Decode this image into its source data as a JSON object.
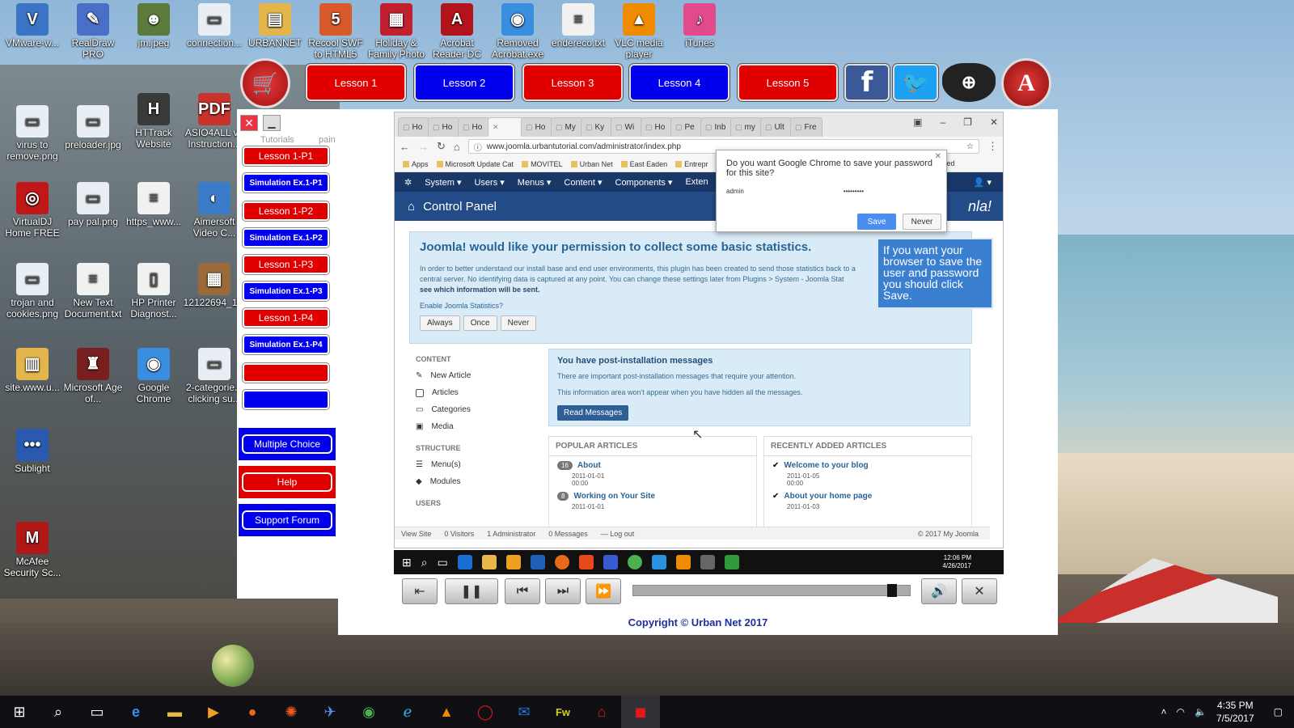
{
  "desktop_icons": [
    {
      "label": "VMware-w...",
      "color": "#3a74c4",
      "glyph": "V"
    },
    {
      "label": "RealDraw PRO",
      "color": "#4a6fc9",
      "glyph": "✎"
    },
    {
      "label": "jm.jpeg",
      "color": "#5c7a3c",
      "glyph": "☻"
    },
    {
      "label": "connection...",
      "color": "#e8eef4",
      "glyph": "▭"
    },
    {
      "label": "URBANNET",
      "color": "#e2b64a",
      "glyph": "▤"
    },
    {
      "label": "Recool SWF to HTML5",
      "color": "#d85a2a",
      "glyph": "5"
    },
    {
      "label": "Holiday & Family Photo",
      "color": "#c02030",
      "glyph": "▦"
    },
    {
      "label": "Acrobat Reader DC",
      "color": "#b3131a",
      "glyph": "A"
    },
    {
      "label": "Removed Acrobat.exe",
      "color": "#3a8ee0",
      "glyph": "◉"
    },
    {
      "label": "endereco.txt",
      "color": "#f1f1f1",
      "glyph": "≡"
    },
    {
      "label": "VLC media player",
      "color": "#f08a00",
      "glyph": "▲"
    },
    {
      "label": "iTunes",
      "color": "#e24a8c",
      "glyph": "♪"
    },
    {
      "label": "virus to remove.png",
      "color": "#e8eef4",
      "glyph": "▭"
    },
    {
      "label": "preloader.jpg",
      "color": "#e8eef4",
      "glyph": "▭"
    },
    {
      "label": "HTTrack Website Copier",
      "color": "#3a3a3a",
      "glyph": "H"
    },
    {
      "label": "ASIO4ALL v2 Instruction...",
      "color": "#c8332c",
      "glyph": "PDF"
    },
    {
      "label": "VirtualDJ Home FREE",
      "color": "#c01818",
      "glyph": "◎"
    },
    {
      "label": "pay pal.png",
      "color": "#e8eef4",
      "glyph": "▭"
    },
    {
      "label": "https_www...",
      "color": "#f1f1f1",
      "glyph": "≡"
    },
    {
      "label": "Aimersoft Video C...",
      "color": "#3b7cc9",
      "glyph": "◐"
    },
    {
      "label": "trojan and cookies.png",
      "color": "#e8eef4",
      "glyph": "▭"
    },
    {
      "label": "New Text Document.txt",
      "color": "#f1f1f1",
      "glyph": "≡"
    },
    {
      "label": "HP Printer Diagnost...",
      "color": "#f1f1f1",
      "glyph": "▯"
    },
    {
      "label": "12122694_1...",
      "color": "#9a6a3a",
      "glyph": "▦"
    },
    {
      "label": "site.www.u...",
      "color": "#e2b64a",
      "glyph": "▥"
    },
    {
      "label": "Microsoft Age of...",
      "color": "#7a1f1f",
      "glyph": "♜"
    },
    {
      "label": "Google Chrome",
      "color": "#3a8ee0",
      "glyph": "◉"
    },
    {
      "label": "2-categorie... clicking su...",
      "color": "#e8eef4",
      "glyph": "▭"
    },
    {
      "label": "Sublight",
      "color": "#2a5ab0",
      "glyph": "•••"
    },
    {
      "label": "McAfee Security Sc...",
      "color": "#b01818",
      "glyph": "M"
    }
  ],
  "toolbar": {
    "lessons": [
      "Lesson 1",
      "Lesson 2",
      "Lesson 3",
      "Lesson 4",
      "Lesson 5"
    ]
  },
  "left_panel": {
    "items": [
      "Lesson 1-P1",
      "Simulation Ex.1-P1",
      "Lesson 1-P2",
      "Simulation Ex.1-P2",
      "Lesson 1-P3",
      "Simulation Ex.1-P3",
      "Lesson 1-P4",
      "Simulation Ex.1-P4",
      "",
      ""
    ],
    "multiple_choice": "Multiple Choice",
    "help": "Help",
    "support": "Support Forum",
    "bg_text_1": "Tutorials",
    "bg_text_2": "pain"
  },
  "chrome": {
    "tabs": [
      "Ho",
      "Ho",
      "Ho",
      "",
      "Ho",
      "My",
      "Ky",
      "Wi",
      "Ho",
      "Pe",
      "Inb",
      "my",
      "Ult",
      "Fre"
    ],
    "url": "www.joomla.urbantutorial.com/administrator/index.php",
    "bookmarks": [
      "Apps",
      "Microsoft Update Cat",
      "MOVITEL",
      "Urban Net",
      "East Eaden",
      "Entrepr"
    ],
    "bookmarks_right": "ified"
  },
  "joomla": {
    "menu": [
      "System ▾",
      "Users ▾",
      "Menus ▾",
      "Content ▾",
      "Components ▾",
      "Exten"
    ],
    "page_title": "Control Panel",
    "logo_text": "nla!",
    "stats_title": "Joomla! would like your permission to collect some basic statistics.",
    "stats_text": "In order to better understand our install base and end user environments, this plugin has been created to send those statistics back to a central server. No identifying data is captured at any point. You can change these settings later from Plugins > System - Joomla Stat",
    "stats_bold": "see which information will be sent.",
    "stats_enable": "Enable Joomla Statistics?",
    "stats_buttons": [
      "Always",
      "Once",
      "Never"
    ],
    "sidebar": {
      "content_header": "CONTENT",
      "content_items": [
        "New Article",
        "Articles",
        "Categories",
        "Media"
      ],
      "structure_header": "STRUCTURE",
      "structure_items": [
        "Menu(s)",
        "Modules"
      ],
      "users_header": "USERS"
    },
    "post_title": "You have post-installation messages",
    "post_text1": "There are important post-installation messages that require your attention.",
    "post_text2": "This information area won't appear when you have hidden all the messages.",
    "post_button": "Read Messages",
    "popular_header": "POPULAR ARTICLES",
    "popular": [
      {
        "count": "16",
        "title": "About",
        "date": "2011-01-01",
        "time": "00:00"
      },
      {
        "count": "8",
        "title": "Working on Your Site",
        "date": "2011-01-01"
      }
    ],
    "recent_header": "RECENTLY ADDED ARTICLES",
    "recent": [
      {
        "title": "Welcome to your blog",
        "date": "2011-01-05",
        "time": "00:00"
      },
      {
        "title": "About your home page",
        "date": "2011-01-03"
      }
    ],
    "footer": [
      "View Site",
      "0 Visitors",
      "1 Administrator",
      "0 Messages",
      "— Log out"
    ],
    "footer_right": "© 2017 My Joomla"
  },
  "password_popup": {
    "question": "Do you want Google Chrome to save your password for this site?",
    "username": "admin",
    "password": "•••••••••",
    "save": "Save",
    "never": "Never"
  },
  "callout": "If you want your browser to save the user and password you should click Save.",
  "inner_taskbar": {
    "time": "12:06 PM",
    "date": "4/26/2017"
  },
  "player": {
    "progress": 0.95
  },
  "copyright": "Copyright © Urban Net 2017",
  "taskbar": {
    "time": "4:35 PM",
    "date": "7/5/2017"
  }
}
